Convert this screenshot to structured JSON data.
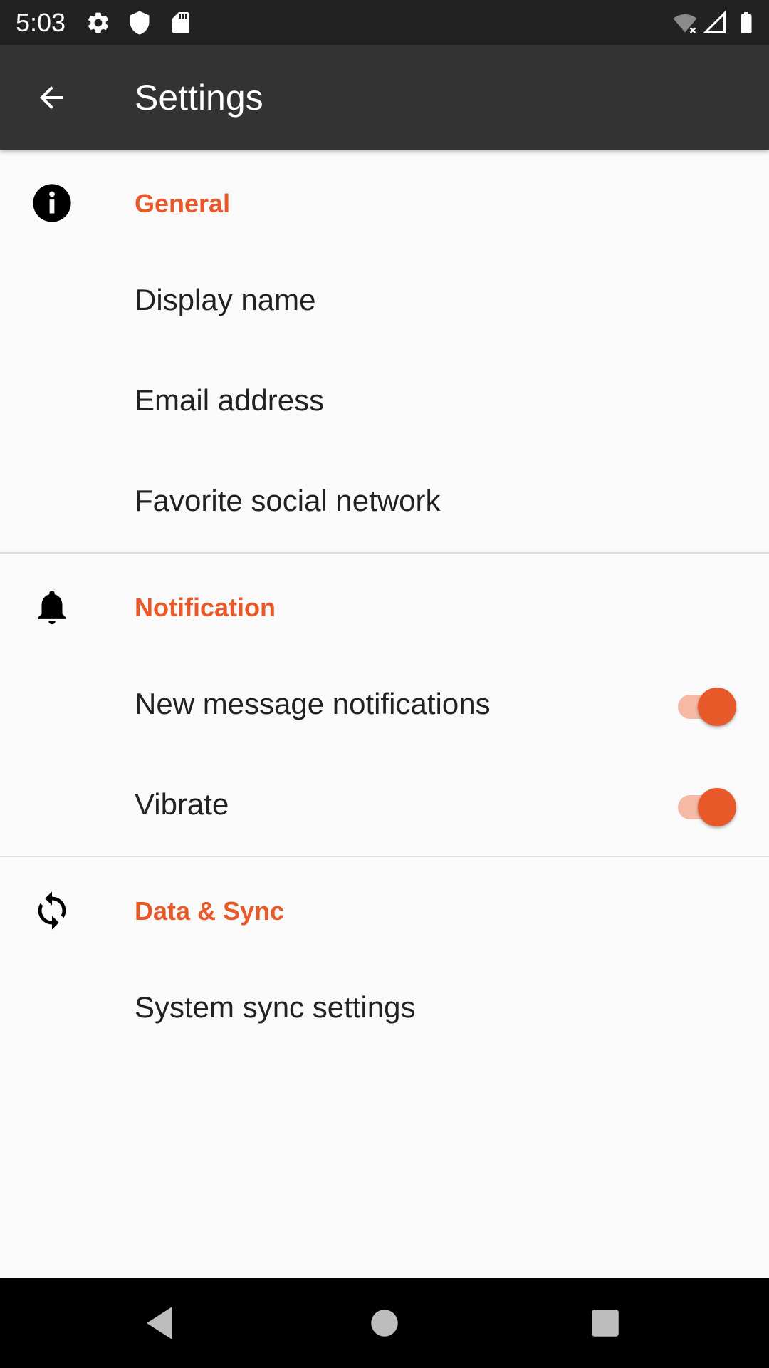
{
  "status_bar": {
    "time": "5:03",
    "left_icons": [
      "gear-icon",
      "shield-icon",
      "sd-card-icon"
    ],
    "right_icons": [
      "wifi-off-icon",
      "signal-icon",
      "battery-icon"
    ]
  },
  "app_bar": {
    "title": "Settings",
    "back_icon": "arrow-left-icon"
  },
  "colors": {
    "accent": "#e8592a",
    "app_bar": "#333333",
    "status_bar": "#222222",
    "background": "#fafafa"
  },
  "sections": [
    {
      "title": "General",
      "icon": "info-icon",
      "items": [
        {
          "label": "Display name"
        },
        {
          "label": "Email address"
        },
        {
          "label": "Favorite social network"
        }
      ]
    },
    {
      "title": "Notification",
      "icon": "bell-icon",
      "items": [
        {
          "label": "New message notifications",
          "toggle": true
        },
        {
          "label": "Vibrate",
          "toggle": true
        }
      ]
    },
    {
      "title": "Data & Sync",
      "icon": "sync-icon",
      "items": [
        {
          "label": "System sync settings"
        }
      ]
    }
  ],
  "nav_bar": {
    "buttons": [
      "back-triangle-icon",
      "home-circle-icon",
      "recents-square-icon"
    ]
  }
}
